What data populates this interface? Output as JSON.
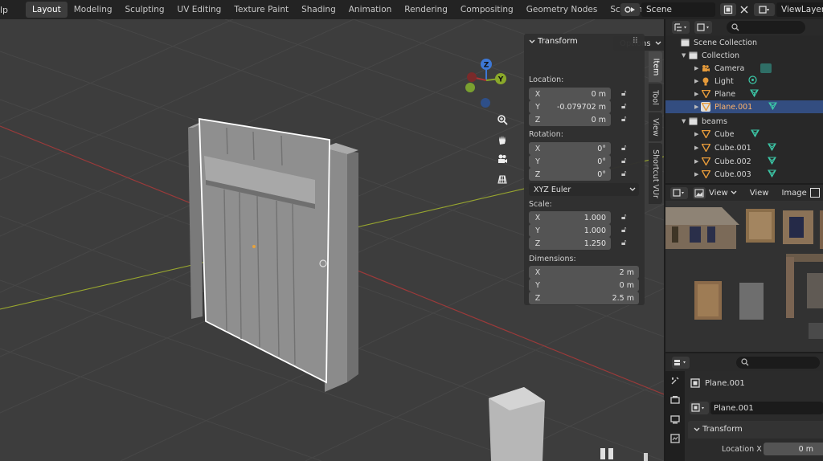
{
  "topbar": {
    "help": "lp",
    "workspaces": [
      "Layout",
      "Modeling",
      "Sculpting",
      "UV Editing",
      "Texture Paint",
      "Shading",
      "Animation",
      "Rendering",
      "Compositing",
      "Geometry Nodes",
      "Scripting"
    ],
    "plus": "+",
    "scene": "Scene",
    "view_layer": "ViewLayer"
  },
  "viewport": {
    "options_label": "Options",
    "gizmo": {
      "z": "Z",
      "y": "Y"
    },
    "colors": {
      "x_axis": "#b93a3a",
      "y_axis": "#9fb62c",
      "z_axis": "#3d78d6"
    }
  },
  "npanel": {
    "title": "Transform",
    "location_label": "Location:",
    "location": [
      {
        "axis": "X",
        "value": "0 m"
      },
      {
        "axis": "Y",
        "value": "-0.079702 m"
      },
      {
        "axis": "Z",
        "value": "0 m"
      }
    ],
    "rotation_label": "Rotation:",
    "rotation": [
      {
        "axis": "X",
        "value": "0°"
      },
      {
        "axis": "Y",
        "value": "0°"
      },
      {
        "axis": "Z",
        "value": "0°"
      }
    ],
    "rotation_mode": "XYZ Euler",
    "scale_label": "Scale:",
    "scale": [
      {
        "axis": "X",
        "value": "1.000"
      },
      {
        "axis": "Y",
        "value": "1.000"
      },
      {
        "axis": "Z",
        "value": "1.250"
      }
    ],
    "dimensions_label": "Dimensions:",
    "dimensions": [
      {
        "axis": "X",
        "value": "2 m"
      },
      {
        "axis": "Y",
        "value": "0 m"
      },
      {
        "axis": "Z",
        "value": "2.5 m"
      }
    ],
    "tabs": [
      "Item",
      "Tool",
      "View",
      "Shortcut VUr"
    ]
  },
  "outliner": {
    "rows": [
      {
        "label": "Scene Collection",
        "icon": "scene-collection-icon"
      },
      {
        "label": "Collection",
        "icon": "collection-icon"
      },
      {
        "label": "Camera",
        "icon": "camera-icon"
      },
      {
        "label": "Light",
        "icon": "light-icon"
      },
      {
        "label": "Plane",
        "icon": "mesh-icon"
      },
      {
        "label": "Plane.001",
        "icon": "mesh-icon",
        "selected": true
      },
      {
        "label": "beams",
        "icon": "collection-icon"
      },
      {
        "label": "Cube",
        "icon": "mesh-icon"
      },
      {
        "label": "Cube.001",
        "icon": "mesh-icon"
      },
      {
        "label": "Cube.002",
        "icon": "mesh-icon"
      },
      {
        "label": "Cube.003",
        "icon": "mesh-icon"
      }
    ]
  },
  "image_editor": {
    "view": "View",
    "view2": "View",
    "image": "Image"
  },
  "properties": {
    "object_name": "Plane.001",
    "mesh_name": "Plane.001",
    "section": "Transform",
    "location_x_label": "Location X",
    "location_x_value": "0 m"
  }
}
